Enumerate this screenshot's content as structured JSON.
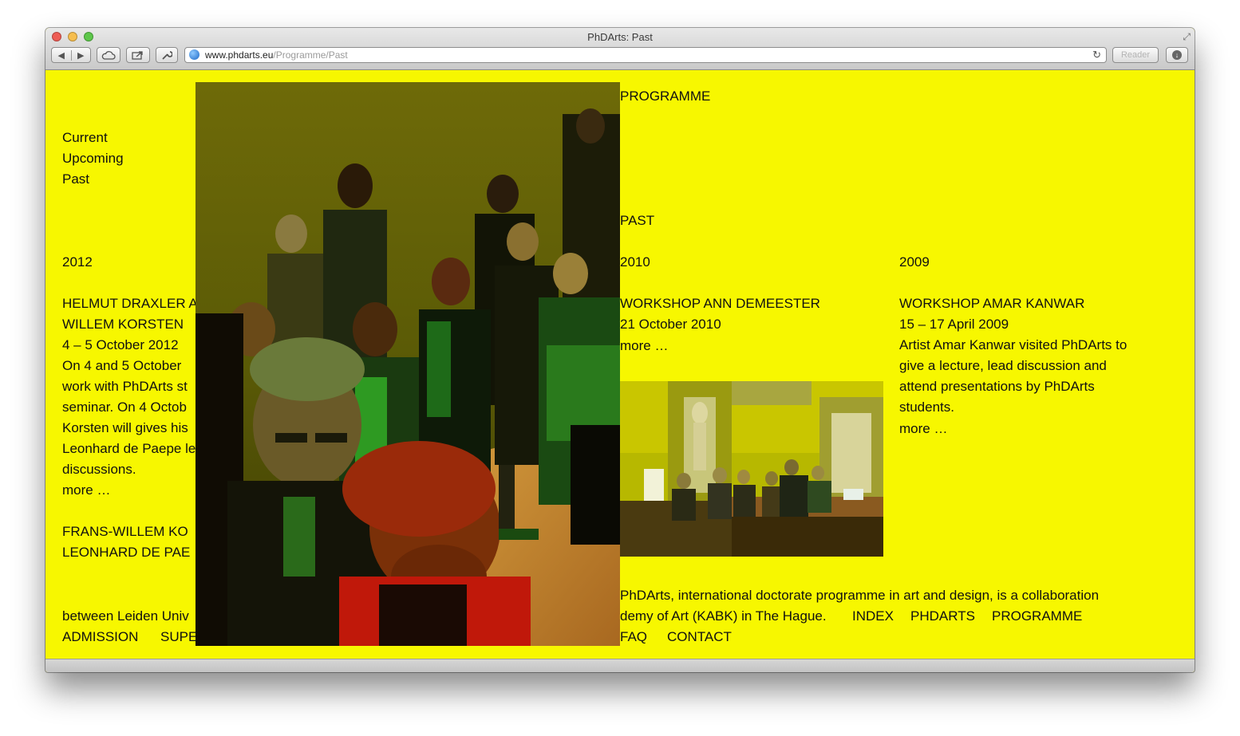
{
  "browser": {
    "window_title": "PhDArts: Past",
    "url_domain": "www.phdarts.eu",
    "url_path": "/Programme/Past",
    "reader_label": "Reader"
  },
  "subnav": {
    "current": "Current",
    "upcoming": "Upcoming",
    "past": "Past"
  },
  "heading": "PROGRAMME",
  "section": "PAST",
  "columns": [
    {
      "year": "2012",
      "events": [
        {
          "title": [
            "HELMUT DRAXLER A",
            "WILLEM KORSTEN"
          ],
          "date": "4 – 5 October 2012",
          "desc": [
            "On 4 and 5 October",
            "work with PhDArts st",
            "seminar. On 4 Octob",
            "Korsten will gives his",
            "Leonhard de Paepe le",
            "discussions."
          ],
          "more": "more …"
        },
        {
          "title": [
            "FRANS-WILLEM KO",
            "LEONHARD DE PAE"
          ]
        }
      ]
    },
    {
      "year": "2010",
      "events": [
        {
          "title": [
            "WORKSHOP ANN DEMEESTER"
          ],
          "date": "21 October 2010",
          "more": "more …"
        }
      ]
    },
    {
      "year": "2009",
      "events": [
        {
          "title": [
            "WORKSHOP AMAR KANWAR"
          ],
          "date": "15 – 17 April 2009",
          "desc": [
            "Artist Amar Kanwar visited PhDArts to",
            "give a lecture, lead discussion and",
            "attend presentations by PhDArts",
            "students."
          ],
          "more": "more …"
        }
      ]
    }
  ],
  "footer": {
    "line1": "PhDArts, international doctorate programme in art and design, is a collaboration",
    "line2_left": "between Leiden Univ",
    "line2_right": "demy of Art (KABK) in The Hague.",
    "nav": {
      "index": "INDEX",
      "phdarts": "PHDARTS",
      "programme": "PROGRAMME",
      "admission": "ADMISSION",
      "supervision": "SUPE",
      "faq": "FAQ",
      "contact": "CONTACT"
    }
  },
  "colors": {
    "page_background": "#f7f700",
    "text": "#111111"
  }
}
